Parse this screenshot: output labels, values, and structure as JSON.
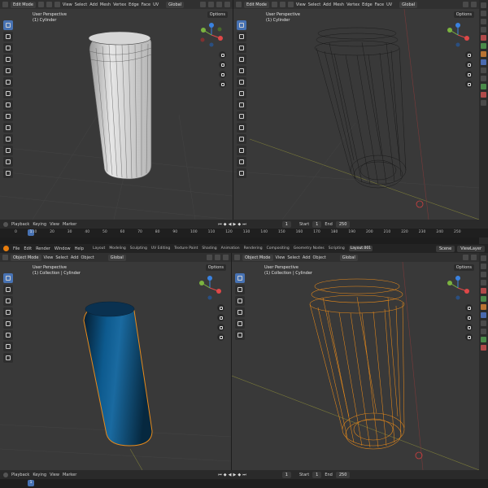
{
  "top_left": {
    "mode": "Edit Mode",
    "menus": [
      "View",
      "Select",
      "Add",
      "Mesh",
      "Vertex",
      "Edge",
      "Face",
      "UV"
    ],
    "orientation": "Global",
    "options": "Options",
    "view_label": "User Perspective",
    "object_label": "(1) Cylinder"
  },
  "top_right": {
    "mode": "Edit Mode",
    "menus": [
      "View",
      "Select",
      "Add",
      "Mesh",
      "Vertex",
      "Edge",
      "Face",
      "UV"
    ],
    "orientation": "Global",
    "options": "Options",
    "view_label": "User Perspective",
    "object_label": "(1) Cylinder"
  },
  "timeline_top": {
    "menus": [
      "Playback",
      "Keying",
      "View",
      "Marker"
    ],
    "current_frame": "1",
    "frame_field": "1",
    "start_label": "Start",
    "start": "1",
    "end_label": "End",
    "end": "250",
    "ticks": [
      "0",
      "10",
      "20",
      "30",
      "40",
      "50",
      "60",
      "70",
      "80",
      "90",
      "100",
      "110",
      "120",
      "130",
      "140",
      "150",
      "160",
      "170",
      "180",
      "190",
      "200",
      "210",
      "220",
      "230",
      "240",
      "250"
    ]
  },
  "app_menu": {
    "menus": [
      "File",
      "Edit",
      "Render",
      "Window",
      "Help"
    ],
    "workspaces": [
      "Layout",
      "Modeling",
      "Sculpting",
      "UV Editing",
      "Texture Paint",
      "Shading",
      "Animation",
      "Rendering",
      "Compositing",
      "Geometry Nodes",
      "Scripting",
      "Layout.001"
    ],
    "active_workspace": "Layout.001",
    "scene": "Scene",
    "view_layer": "ViewLayer"
  },
  "bottom_left": {
    "mode": "Object Mode",
    "menus": [
      "View",
      "Select",
      "Add",
      "Object"
    ],
    "orientation": "Global",
    "options": "Options",
    "view_label": "User Perspective",
    "object_label": "(1) Collection | Cylinder",
    "accent": "#0a4c7a"
  },
  "bottom_right": {
    "mode": "Object Mode",
    "menus": [
      "View",
      "Select",
      "Add",
      "Object"
    ],
    "orientation": "Global",
    "options": "Options",
    "view_label": "User Perspective",
    "object_label": "(1) Collection | Cylinder",
    "accent": "#e88a1a"
  },
  "timeline_bottom": {
    "menus": [
      "Playback",
      "Keying",
      "View",
      "Marker"
    ],
    "current_frame": "1",
    "frame_field": "1",
    "start_label": "Start",
    "start": "1",
    "end_label": "End",
    "end": "250"
  },
  "icons": {
    "editor_type": "cube-icon",
    "select_tool": "cursor-icon",
    "move": "move-icon",
    "rotate": "rotate-icon",
    "scale": "scale-icon",
    "transform": "transform-icon",
    "annotate": "annotate-icon",
    "measure": "ruler-icon",
    "zoom": "magnifier-icon",
    "pan": "hand-icon",
    "camera": "camera-icon",
    "perspective": "grid-icon"
  },
  "colors": {
    "viewport_bg": "#393939",
    "header_bg": "#303030",
    "active_tool": "#4772b3",
    "axis_x": "#e04848",
    "axis_y": "#7bb33f",
    "axis_z": "#3a82e0"
  }
}
